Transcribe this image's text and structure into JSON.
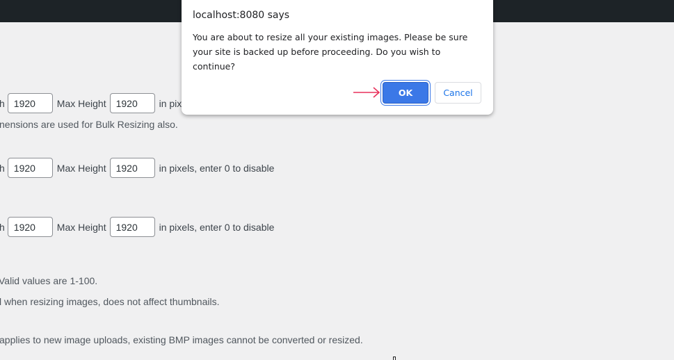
{
  "dialog": {
    "title": "localhost:8080 says",
    "message": "You are about to resize all your existing images. Please be sure your site is backed up before proceeding. Do you wish to continue?",
    "ok_label": "OK",
    "cancel_label": "Cancel"
  },
  "annotation": {
    "arrow_color": "#e8315b"
  },
  "settings": {
    "rows": [
      {
        "width_label_tail": "h",
        "width_value": "1920",
        "height_label": "Max Height",
        "height_value": "1920",
        "suffix": "in pix"
      },
      {
        "width_label_tail": "h",
        "width_value": "1920",
        "height_label": "Max Height",
        "height_value": "1920",
        "suffix": "in pixels, enter 0 to disable"
      },
      {
        "width_label_tail": "h",
        "width_value": "1920",
        "height_label": "Max Height",
        "height_value": "1920",
        "suffix": "in pixels, enter 0 to disable"
      }
    ],
    "bulk_note": "nensions are used for Bulk Resizing also.",
    "quality_note": "Valid values are 1-100.",
    "resize_note": "l when resizing images, does not affect thumbnails.",
    "bmp_note": "applies to new image uploads, existing BMP images cannot be converted or resized."
  }
}
